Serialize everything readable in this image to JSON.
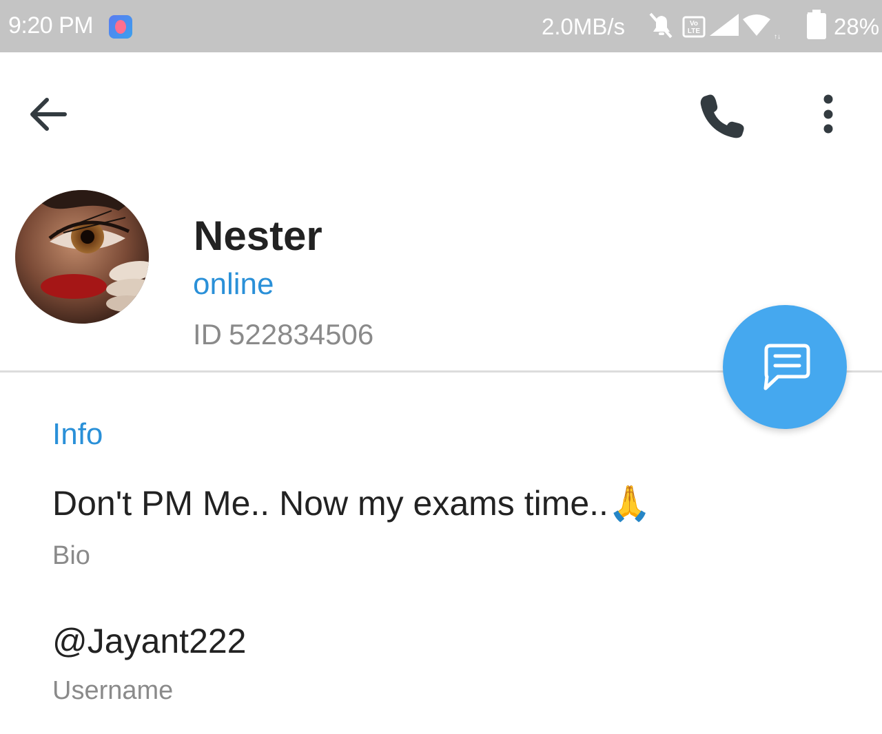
{
  "status_bar": {
    "time": "9:20 PM",
    "network_speed": "2.0MB/s",
    "volte_label": "Vo\nLTE",
    "battery": "28%",
    "icons": [
      "app-notification-icon",
      "mute-icon",
      "volte-icon",
      "signal-icon",
      "wifi-icon",
      "battery-icon"
    ]
  },
  "toolbar": {
    "icons": [
      "back-arrow-icon",
      "phone-icon",
      "more-vert-icon"
    ]
  },
  "profile": {
    "name": "Nester",
    "status": "online",
    "id_prefix": "ID",
    "id_value": "522834506",
    "avatar_icon": "avatar-photo"
  },
  "fab": {
    "icon": "message-icon",
    "color": "#45a8ef"
  },
  "info": {
    "title": "Info",
    "bio_value": "Don't PM Me.. Now my exams time..🙏",
    "bio_label": "Bio",
    "username_value": "@Jayant222",
    "username_label": "Username"
  },
  "colors": {
    "accent": "#2a90d8",
    "status_bar": "#c4c4c4",
    "primary_text": "#222222",
    "secondary_text": "#8a8a8a"
  }
}
